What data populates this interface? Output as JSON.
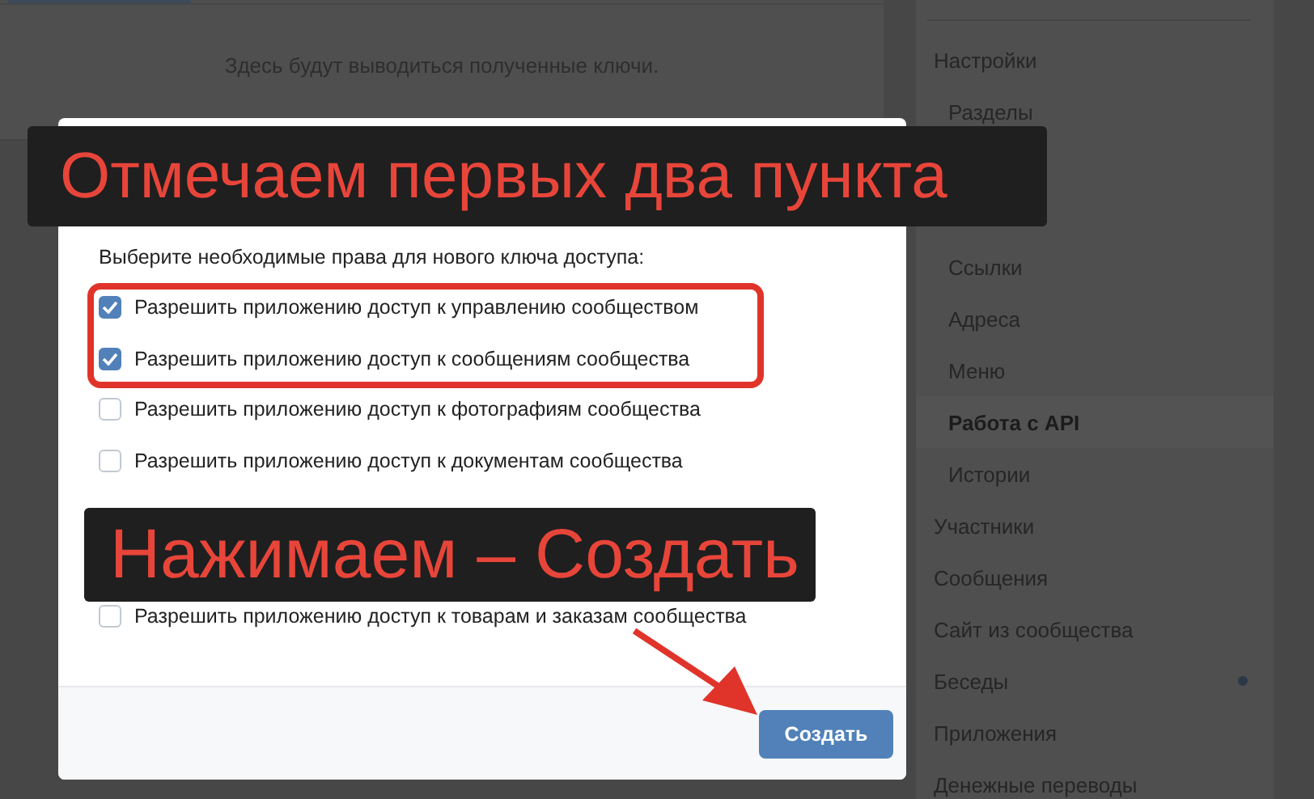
{
  "keys_panel": {
    "empty_text": "Здесь будут выводиться полученные ключи."
  },
  "sidebar": {
    "items": [
      {
        "label": "Настройки",
        "selected": false,
        "dot": false,
        "children": [
          {
            "label": "Разделы",
            "selected": false
          },
          {
            "label": "Ссылки",
            "selected": false
          },
          {
            "label": "Адреса",
            "selected": false
          },
          {
            "label": "Меню",
            "selected": false
          },
          {
            "label": "Работа с API",
            "selected": true
          },
          {
            "label": "Истории",
            "selected": false
          }
        ]
      },
      {
        "label": "Участники",
        "selected": false,
        "dot": false
      },
      {
        "label": "Сообщения",
        "selected": false,
        "dot": false
      },
      {
        "label": "Сайт из сообщества",
        "selected": false,
        "dot": false
      },
      {
        "label": "Беседы",
        "selected": false,
        "dot": true
      },
      {
        "label": "Приложения",
        "selected": false,
        "dot": false
      },
      {
        "label": "Денежные переводы",
        "selected": false,
        "dot": false
      }
    ]
  },
  "dialog": {
    "intro": "Выберите необходимые права для нового ключа доступа:",
    "permissions": [
      {
        "label": "Разрешить приложению доступ к управлению сообществом",
        "checked": true
      },
      {
        "label": "Разрешить приложению доступ к сообщениям сообщества",
        "checked": true
      },
      {
        "label": "Разрешить приложению доступ к фотографиям сообщества",
        "checked": false
      },
      {
        "label": "Разрешить приложению доступ к документам сообщества",
        "checked": false
      },
      {
        "label": "Разрешить приложению доступ к товарам и заказам сообщества",
        "checked": false
      }
    ],
    "button": "Создать"
  },
  "annotations": [
    {
      "text": "Отмечаем первых два пункта"
    },
    {
      "text": "Нажимаем – Создать"
    }
  ]
}
